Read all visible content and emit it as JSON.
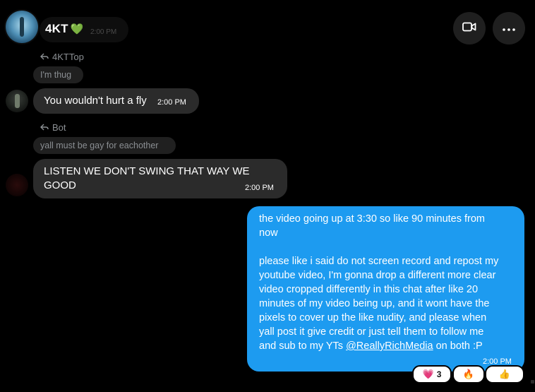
{
  "header": {
    "title": "4KT",
    "time": "2:00 PM",
    "heart_color": "#3fd17b",
    "video_icon": "video-camera-icon",
    "more_icon": "more-horizontal-icon"
  },
  "messages": [
    {
      "reply_to": "4KTTop",
      "quoted": "I'm thug",
      "text": "You wouldn't hurt a fly",
      "time": "2:00 PM"
    },
    {
      "reply_to": "Bot",
      "quoted": "yall must be gay for eachother",
      "text_line1": "LISTEN WE DON'T SWING THAT WAY WE",
      "text_line2": "GOOD",
      "time": "2:00 PM"
    }
  ],
  "outgoing": {
    "line1": "the video going up at 3:30 so like 90 minutes from",
    "line2": "now",
    "line3": "please like i said do not screen record and repost my",
    "line4": "youtube video, I'm gonna drop a different more clear",
    "line5": "video cropped differently in this chat after like 20",
    "line6": "minutes of my video being up, and it wont have the",
    "line7": "pixels to cover up the like nudity, and please when",
    "line8": "yall post it give credit or just tell them to follow me",
    "line9_prefix": "and sub to my YTs",
    "mention": "@ReallyRichMedia",
    "line9_suffix": "on both :P",
    "time": "2:00 PM"
  },
  "reactions": [
    {
      "emoji": "💗",
      "count": "3",
      "icon": "heart-reaction-icon"
    },
    {
      "emoji": "🔥",
      "icon": "fire-reaction-icon"
    },
    {
      "emoji": "👍",
      "icon": "thumbs-up-reaction-icon"
    }
  ],
  "colors": {
    "background": "#000000",
    "incoming_bubble": "#2b2b2b",
    "outgoing_bubble": "#1d9bf0"
  }
}
